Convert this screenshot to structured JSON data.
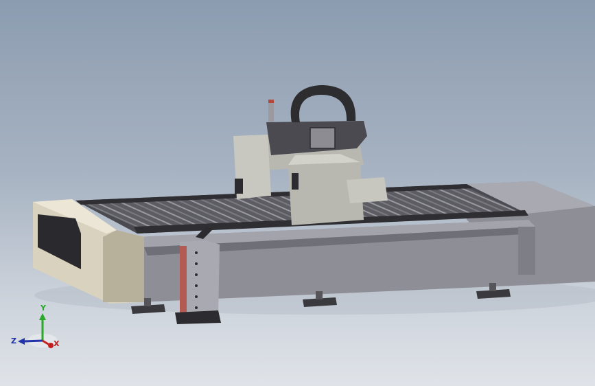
{
  "viewport": {
    "background_top": "#8c9cb0",
    "background_bottom": "#dfe3e8"
  },
  "model": {
    "colors": {
      "frame": "#8e8e96",
      "frame_dark": "#6f6f78",
      "frame_light": "#a9a9b2",
      "end_cap": "#d8d2bf",
      "end_cap_dark": "#b7b09a",
      "slat": "#6d6d73",
      "slat_light": "#9a9aa2",
      "gantry": "#b9b8b0",
      "gantry_dark": "#8f8e86",
      "handle": "#2d2d30",
      "feet": "#3a3a3e",
      "accent_red": "#b5473a"
    }
  },
  "triad": {
    "x_label": "X",
    "y_label": "Y",
    "z_label": "Z",
    "x_color": "#c42020",
    "y_color": "#2aa82a",
    "z_color": "#2233aa"
  }
}
